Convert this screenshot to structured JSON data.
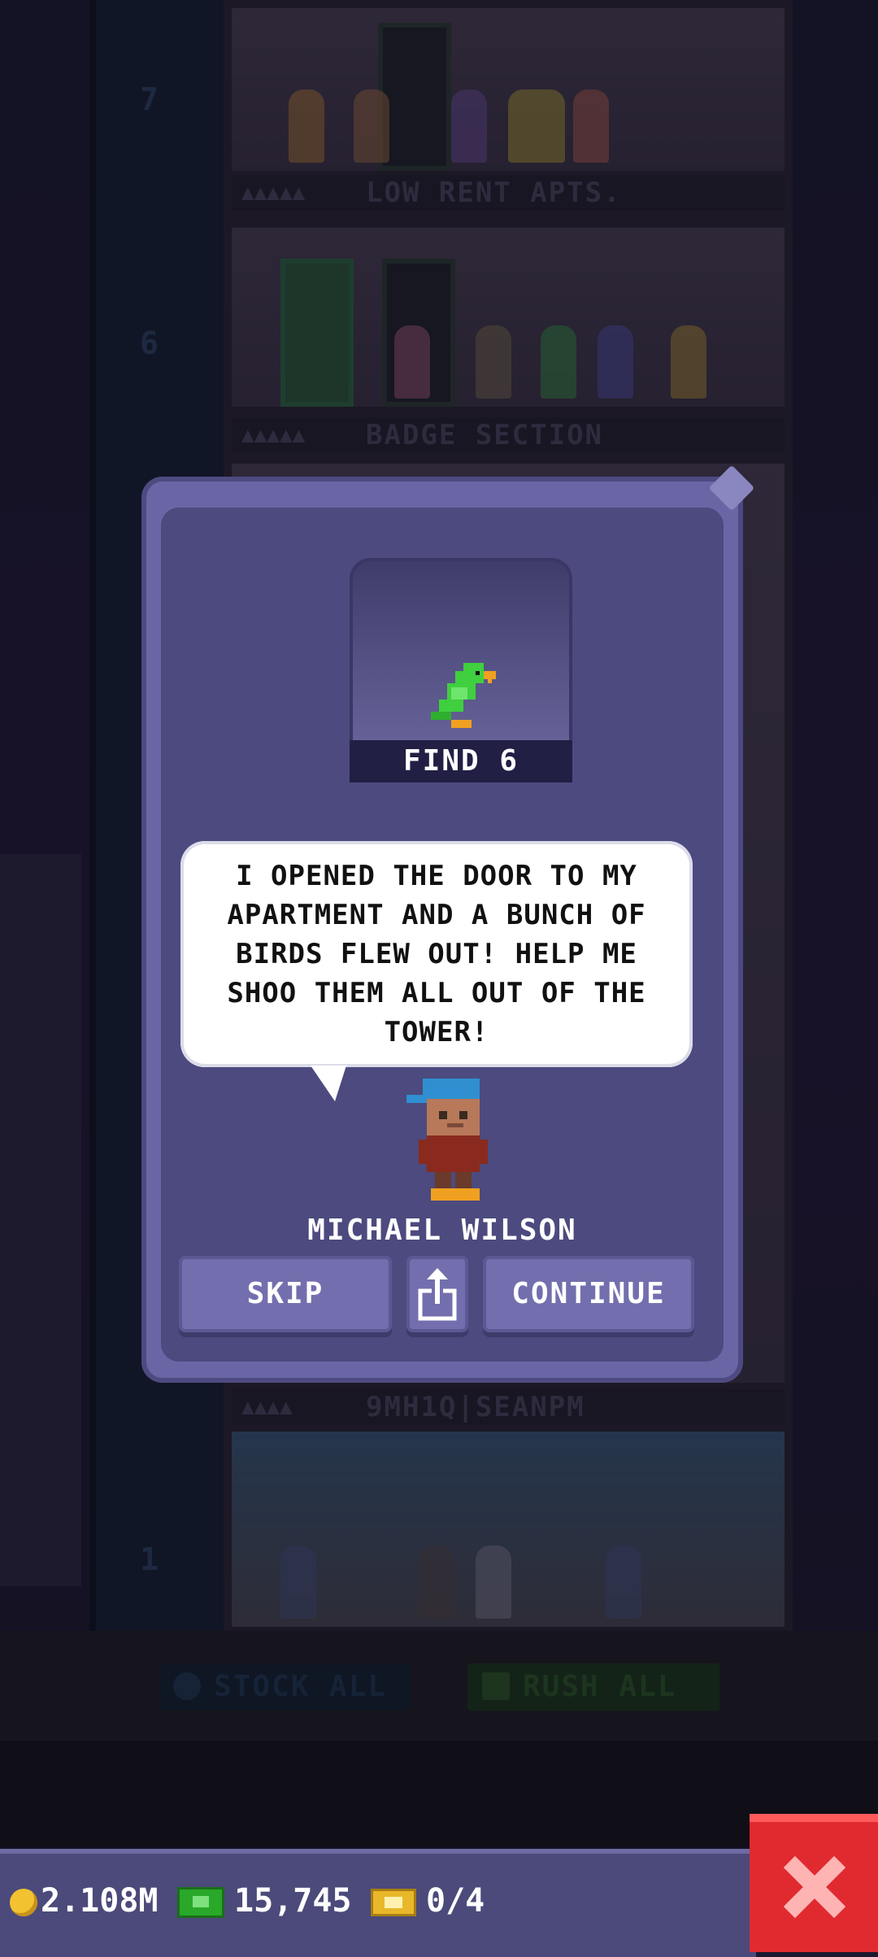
{
  "floors": [
    {
      "number": "7",
      "label": "LOW RENT APTS."
    },
    {
      "number": "6",
      "label": "BADGE SECTION"
    },
    {
      "number": "1",
      "label": "9MH1Q|SEANPM"
    }
  ],
  "action_bar": {
    "stock_all": "STOCK ALL",
    "rush_all": "RUSH ALL"
  },
  "dialog": {
    "quest_caption": "FIND 6",
    "quest_item_icon": "parrot-icon",
    "message": "I OPENED THE DOOR TO MY APARTMENT AND A BUNCH OF BIRDS FLEW OUT! HELP ME SHOO THEM ALL OUT OF THE TOWER!",
    "npc_name": "MICHAEL WILSON",
    "skip_label": "SKIP",
    "continue_label": "CONTINUE"
  },
  "status": {
    "coins": "2.108M",
    "bux": "15,745",
    "tickets": "0/4"
  },
  "colors": {
    "accent": "#6a66a6",
    "close": "#e02a30"
  }
}
